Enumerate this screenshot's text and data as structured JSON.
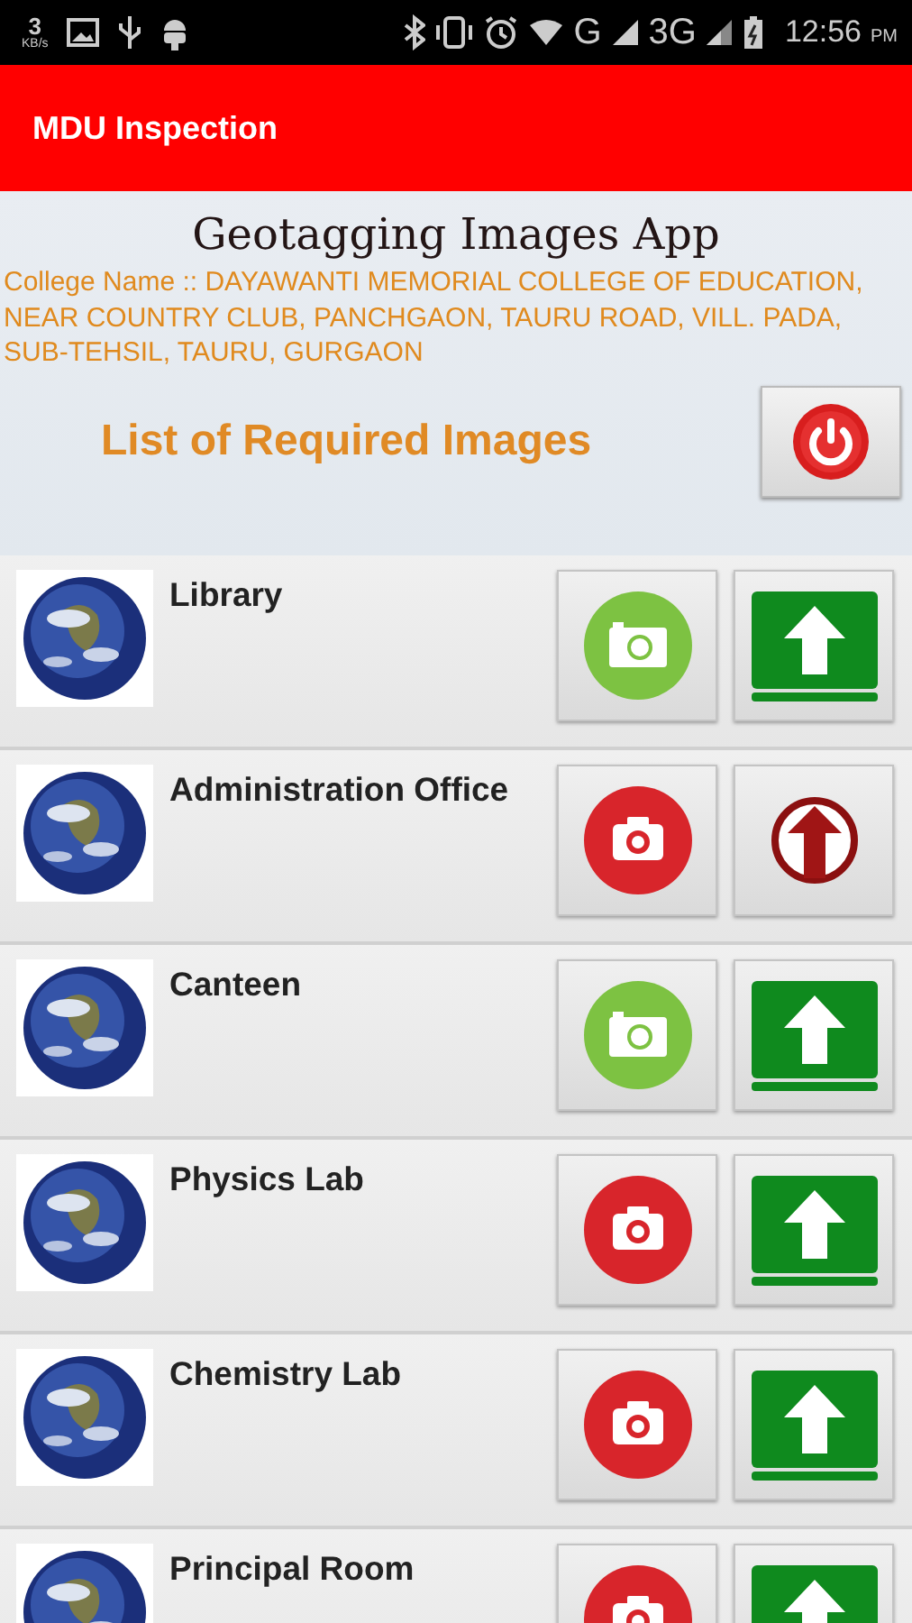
{
  "status_bar": {
    "speed": "3",
    "speed_unit": "KB/s",
    "network_1": "G",
    "network_2": "3G",
    "time": "12:56",
    "ampm": "PM"
  },
  "app_bar": {
    "title": "MDU Inspection"
  },
  "header": {
    "app_title": "Geotagging Images App",
    "college": "College Name :: DAYAWANTI MEMORIAL COLLEGE OF EDUCATION, NEAR COUNTRY CLUB, PANCHGAON, TAURU ROAD, VILL. PADA, SUB-TEHSIL, TAURU, GURGAON",
    "list_title": "List of Required Images"
  },
  "items": [
    {
      "name": "Library",
      "captured": true,
      "upload_enabled": true
    },
    {
      "name": "Administration Office",
      "captured": false,
      "upload_enabled": false
    },
    {
      "name": "Canteen",
      "captured": true,
      "upload_enabled": true
    },
    {
      "name": "Physics Lab",
      "captured": false,
      "upload_enabled": true
    },
    {
      "name": "Chemistry Lab",
      "captured": false,
      "upload_enabled": true
    },
    {
      "name": "Principal Room",
      "captured": false,
      "upload_enabled": true
    }
  ]
}
